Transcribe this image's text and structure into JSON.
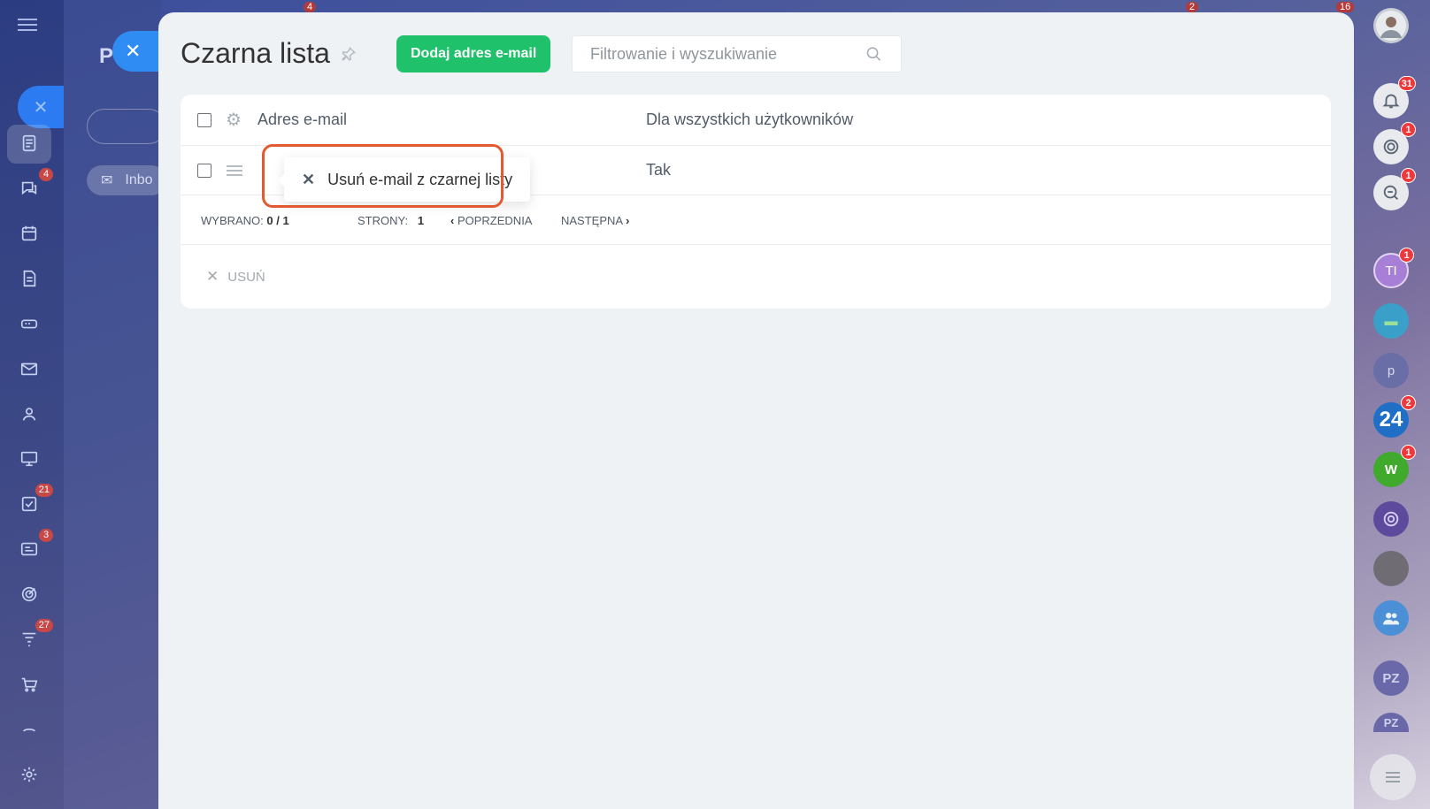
{
  "left_nav": {
    "badges": {
      "chats": "4",
      "tasks": "21",
      "feed": "3",
      "filters": "27"
    }
  },
  "background_page": {
    "title_fragment": "P",
    "inbox_fragment": "Inbo"
  },
  "top_badges": [
    "4",
    "2",
    "16"
  ],
  "panel": {
    "title": "Czarna lista",
    "add_button": "Dodaj adres e-mail",
    "search_placeholder": "Filtrowanie i wyszukiwanie",
    "columns": [
      "Adres e-mail",
      "Dla wszystkich użytkowników"
    ],
    "rows": [
      {
        "email": "",
        "all_users": "Tak"
      }
    ],
    "footer": {
      "selected_label": "WYBRANO:",
      "selected_value": "0 / 1",
      "pages_label": "STRONY:",
      "pages_value": "1",
      "prev": "POPRZEDNIA",
      "next": "NASTĘPNA"
    },
    "delete_action": "USUŃ",
    "popup_item": "Usuń e-mail z czarnej listy"
  },
  "right_bar": {
    "notifications_badge": "31",
    "badge_1": "1",
    "badge_2": "1",
    "avatar_ti": "TI",
    "ti_badge": "1",
    "b24_label": "24",
    "b24_badge": "2",
    "w_label": "W",
    "w_badge": "1",
    "pz_label": "PZ",
    "pz2_label": "PZ"
  },
  "colors": {
    "accent_green": "#1fc16b",
    "highlight_orange": "#e25a2f",
    "blue": "#2e8cf3"
  }
}
